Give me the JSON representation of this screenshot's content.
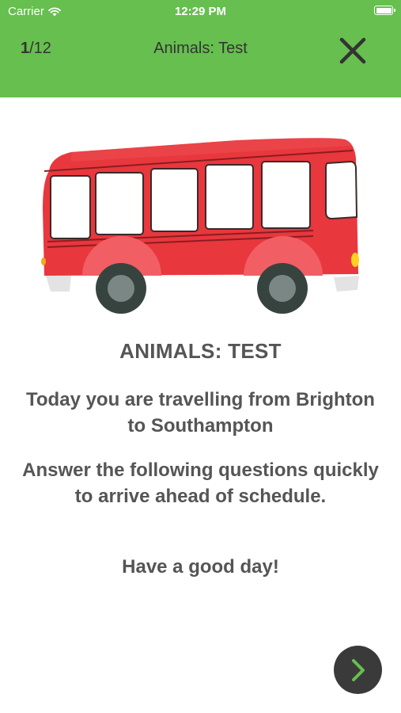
{
  "status_bar": {
    "carrier": "Carrier",
    "time": "12:29 PM"
  },
  "header": {
    "progress_current": "1",
    "progress_total": "/12",
    "title": "Animals: Test",
    "background_color": "#66bf4f"
  },
  "content": {
    "heading": "ANIMALS: TEST",
    "intro": "Today you are travelling from Brighton to Southampton",
    "instructions": "Answer the following questions quickly to arrive ahead of schedule.",
    "farewell": "Have a good day!"
  },
  "icons": {
    "close": "close-icon",
    "next": "chevron-right-icon",
    "illustration": "bus-illustration"
  },
  "colors": {
    "accent": "#66bf4f",
    "bus_red": "#e8373d",
    "next_button": "#3a3a3a"
  }
}
